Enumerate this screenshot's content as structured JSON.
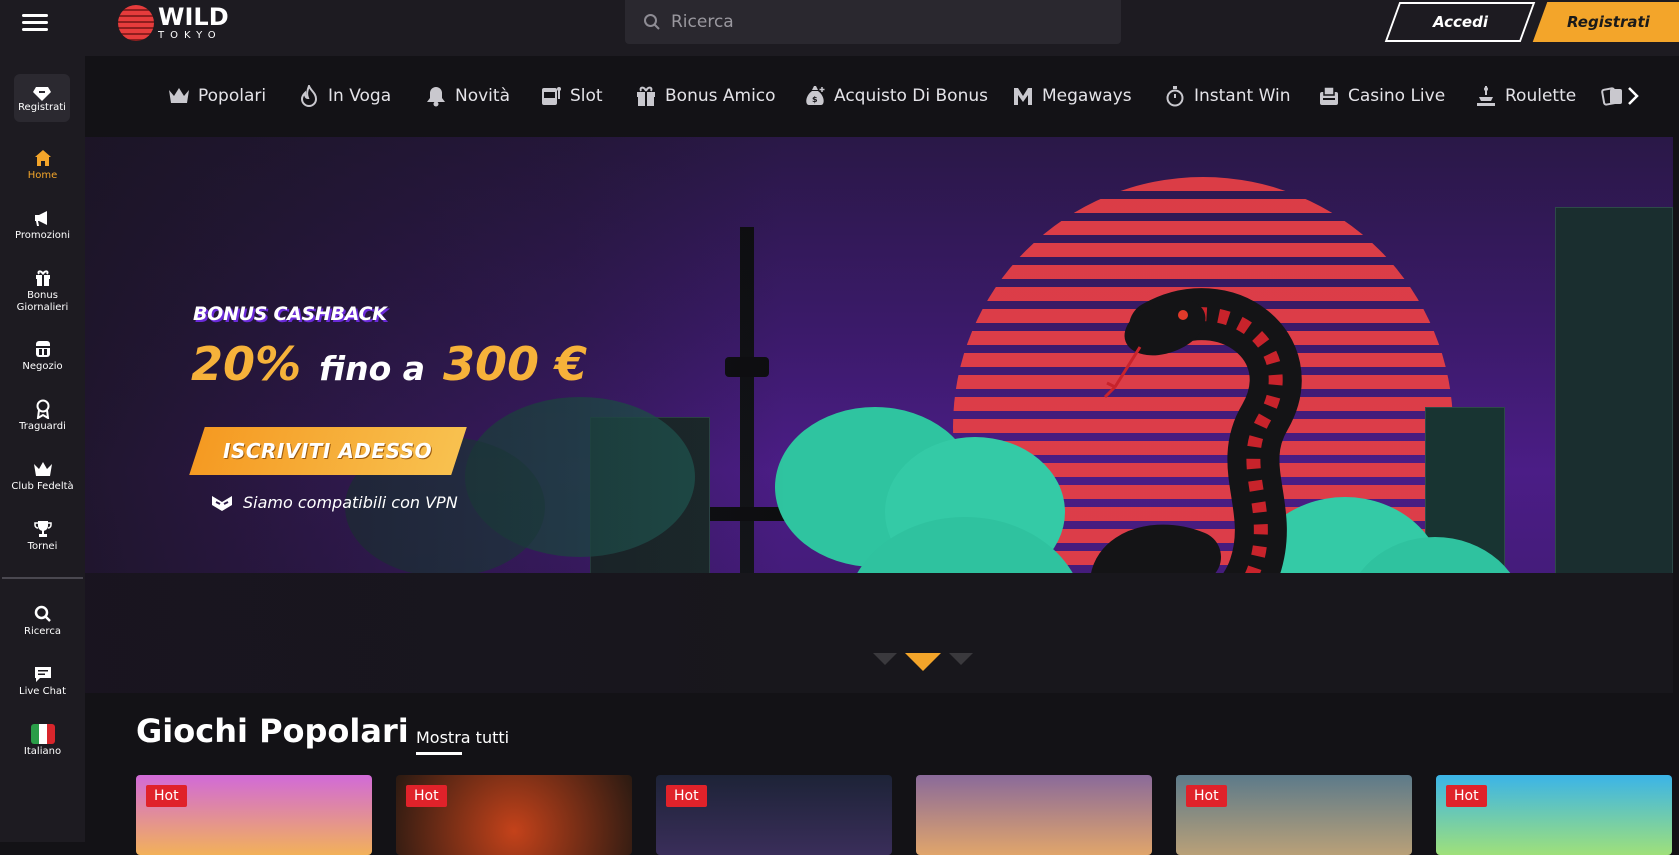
{
  "header": {
    "logo_main": "WILD",
    "logo_sub": "TOKYO",
    "search_placeholder": "Ricerca",
    "login_label": "Accedi",
    "register_label": "Registrati"
  },
  "sidebar": {
    "register_label": "Registrati",
    "items": [
      {
        "label": "Home",
        "icon": "home-icon",
        "active": true
      },
      {
        "label": "Promozioni",
        "icon": "megaphone-icon"
      },
      {
        "label": "Bonus\nGiornalieri",
        "icon": "gift-icon"
      },
      {
        "label": "Negozio",
        "icon": "shop-icon"
      },
      {
        "label": "Traguardi",
        "icon": "medal-icon"
      },
      {
        "label": "Club Fedeltà",
        "icon": "crown-icon"
      },
      {
        "label": "Tornei",
        "icon": "trophy-icon"
      }
    ],
    "bottom_items": [
      {
        "label": "Ricerca",
        "icon": "search-icon"
      },
      {
        "label": "Live Chat",
        "icon": "chat-icon"
      },
      {
        "label": "Italiano",
        "icon": "italy-flag-icon"
      }
    ]
  },
  "categories": [
    {
      "label": "Popolari",
      "icon": "crown-icon"
    },
    {
      "label": "In Voga",
      "icon": "flame-icon"
    },
    {
      "label": "Novità",
      "icon": "bell-icon"
    },
    {
      "label": "Slot",
      "icon": "slot-machine-icon"
    },
    {
      "label": "Bonus Amico",
      "icon": "gift-icon"
    },
    {
      "label": "Acquisto Di Bonus",
      "icon": "money-bag-icon"
    },
    {
      "label": "Megaways",
      "icon": "megaways-icon"
    },
    {
      "label": "Instant Win",
      "icon": "stopwatch-icon"
    },
    {
      "label": "Casino Live",
      "icon": "live-casino-icon"
    },
    {
      "label": "Roulette",
      "icon": "roulette-icon"
    }
  ],
  "hero": {
    "label": "BONUS CASHBACK",
    "percent": "20%",
    "connector": "fino a",
    "amount": "300 €",
    "cta": "ISCRIVITI ADESSO",
    "vpn_text": "Siamo compatibili con VPN"
  },
  "section": {
    "title": "Giochi Popolari",
    "show_all": "Mostra tutti",
    "games": [
      {
        "badge": "Hot"
      },
      {
        "badge": "Hot"
      },
      {
        "badge": "Hot"
      },
      {
        "badge": ""
      },
      {
        "badge": "Hot"
      },
      {
        "badge": "Hot"
      }
    ]
  },
  "colors": {
    "accent": "#f3a52a",
    "background": "#131216",
    "panel": "#1d1b21",
    "hot_badge": "#e0222a"
  }
}
